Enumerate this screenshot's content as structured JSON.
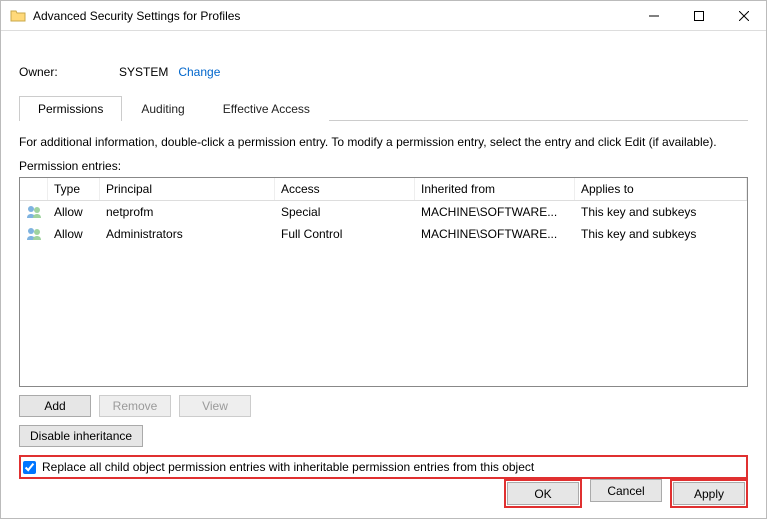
{
  "window": {
    "title": "Advanced Security Settings for Profiles"
  },
  "owner": {
    "label": "Owner:",
    "value": "SYSTEM",
    "change": "Change"
  },
  "tabs": {
    "permissions": "Permissions",
    "auditing": "Auditing",
    "effective": "Effective Access"
  },
  "instructions": "For additional information, double-click a permission entry. To modify a permission entry, select the entry and click Edit (if available).",
  "entries_label": "Permission entries:",
  "columns": {
    "type": "Type",
    "principal": "Principal",
    "access": "Access",
    "inherited": "Inherited from",
    "applies": "Applies to"
  },
  "rows": [
    {
      "type": "Allow",
      "principal": "netprofm",
      "access": "Special",
      "inherited": "MACHINE\\SOFTWARE...",
      "applies": "This key and subkeys"
    },
    {
      "type": "Allow",
      "principal": "Administrators",
      "access": "Full Control",
      "inherited": "MACHINE\\SOFTWARE...",
      "applies": "This key and subkeys"
    }
  ],
  "buttons": {
    "add": "Add",
    "remove": "Remove",
    "view": "View",
    "disable_inh": "Disable inheritance",
    "ok": "OK",
    "cancel": "Cancel",
    "apply": "Apply"
  },
  "checkbox": {
    "label": "Replace all child object permission entries with inheritable permission entries from this object",
    "checked": true
  }
}
